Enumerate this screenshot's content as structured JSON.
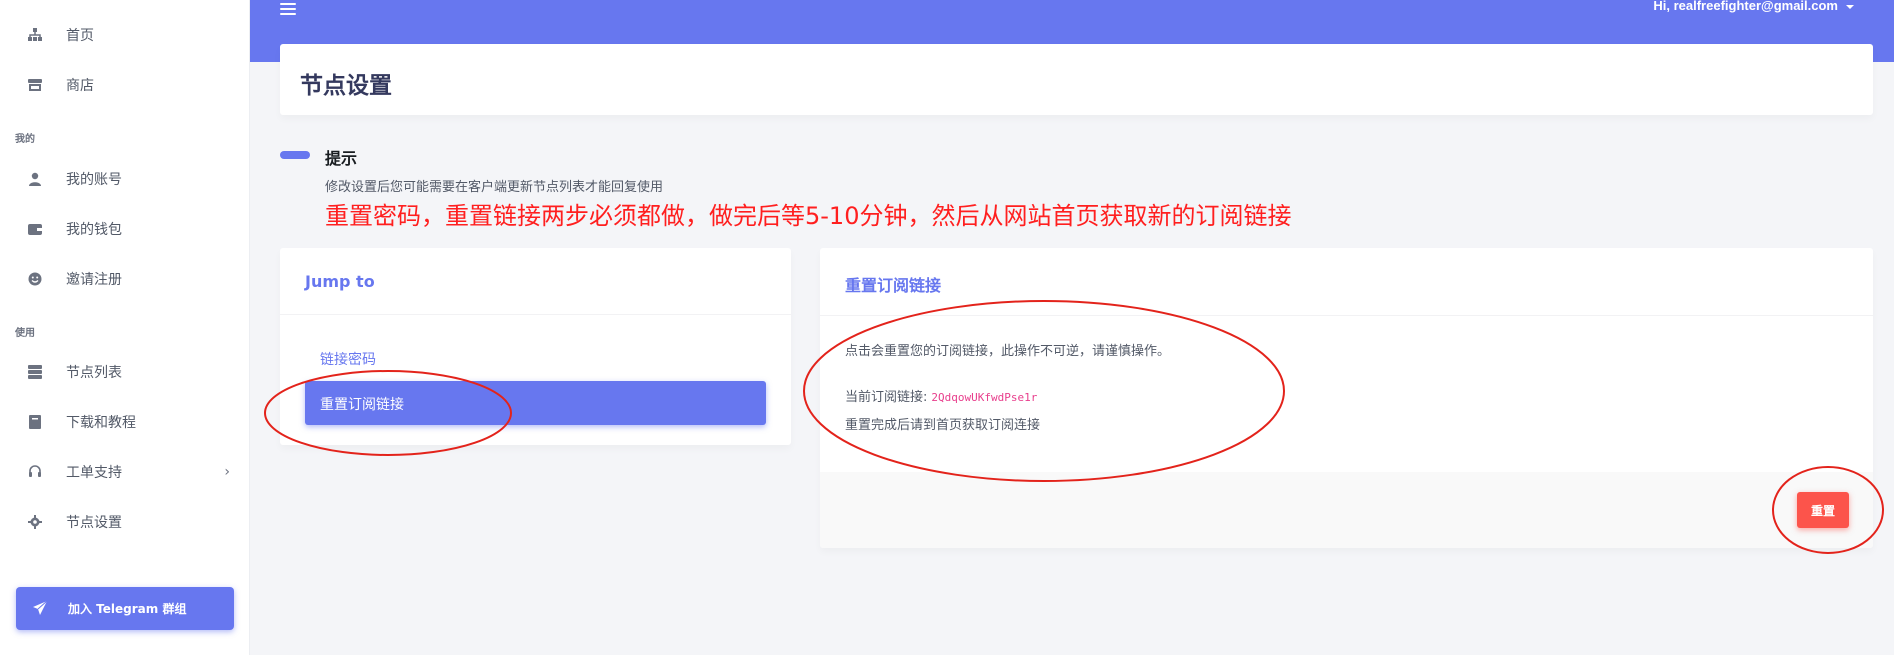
{
  "sidebar": {
    "items": [
      {
        "label": "首页",
        "icon": "sitemap-icon"
      },
      {
        "label": "商店",
        "icon": "store-icon"
      },
      {
        "label": "我的账号",
        "icon": "user-icon"
      },
      {
        "label": "我的钱包",
        "icon": "wallet-icon"
      },
      {
        "label": "邀请注册",
        "icon": "smile-icon"
      },
      {
        "label": "节点列表",
        "icon": "server-icon"
      },
      {
        "label": "下载和教程",
        "icon": "book-icon"
      },
      {
        "label": "工单支持",
        "icon": "headset-icon"
      },
      {
        "label": "节点设置",
        "icon": "gear-icon"
      }
    ],
    "sections": [
      "我的",
      "使用"
    ],
    "telegram_button": "加入 Telegram 群组"
  },
  "topbar": {
    "user_greeting": "Hi, realfreefighter@gmail.com"
  },
  "page": {
    "title": "节点设置"
  },
  "tip": {
    "title": "提示",
    "description": "修改设置后您可能需要在客户端更新节点列表才能回复使用",
    "warning": "重置密码，重置链接两步必须都做，做完后等5-10分钟，然后从网站首页获取新的订阅链接"
  },
  "jump": {
    "title": "Jump to",
    "links": [
      "链接密码",
      "重置订阅链接"
    ]
  },
  "reset_card": {
    "title": "重置订阅链接",
    "line1": "点击会重置您的订阅链接，此操作不可逆，请谨慎操作。",
    "current_label": "当前订阅链接:",
    "current_value": "2QdqowUKfwdPse1r",
    "line3": "重置完成后请到首页获取订阅连接",
    "button": "重置"
  },
  "colors": {
    "primary": "#6777ef",
    "danger": "#fc544b",
    "annotation": "#e3231b",
    "warning_text": "#ff1f1f"
  }
}
